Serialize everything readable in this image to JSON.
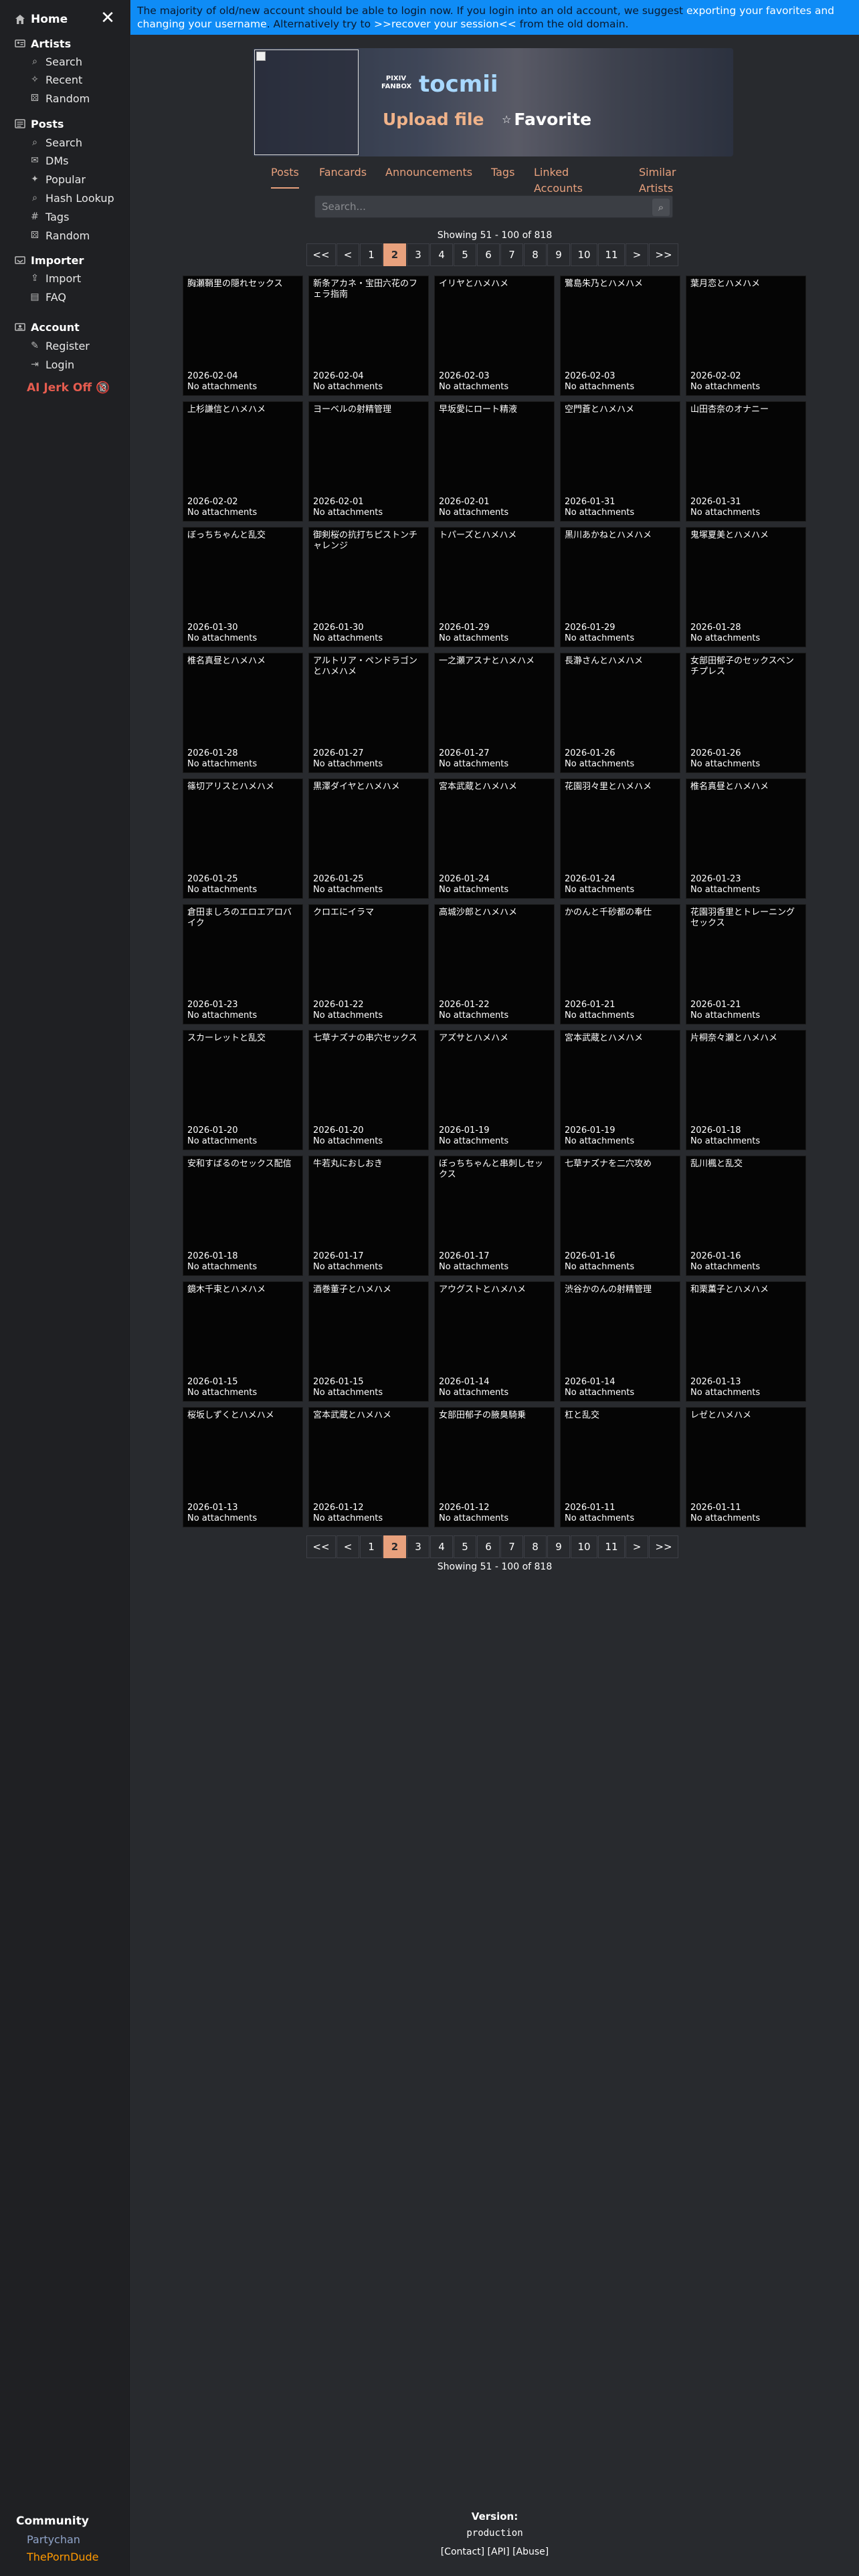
{
  "sidebar": {
    "home": "Home",
    "close": "✕",
    "sections": [
      {
        "title": "Artists",
        "items": [
          "Search",
          "Recent",
          "Random"
        ]
      },
      {
        "title": "Posts",
        "items": [
          "Search",
          "DMs",
          "Popular",
          "Hash Lookup",
          "Tags",
          "Random"
        ]
      },
      {
        "title": "Importer",
        "items": [
          "Import",
          "FAQ"
        ]
      },
      {
        "title": "Account",
        "items": [
          "Register",
          "Login"
        ]
      }
    ],
    "special": "AI Jerk Off 🔞",
    "community": {
      "title": "Community",
      "links": [
        "Partychan",
        "ThePornDude"
      ]
    }
  },
  "banner": {
    "text1": "The majority of old/new account should be able to login now. If you login into an old account, we suggest ",
    "link1": "exporting your favorites and changing your username",
    "text2": ". Alternatively try to ",
    "link2": ">>recover your session<<",
    "text3": " from the old domain."
  },
  "profile": {
    "service": "PIXIV FANBOX",
    "name": "tocmii",
    "upload": "Upload file",
    "favorite": "Favorite",
    "favorite_icon": "☆"
  },
  "tabs": [
    "Posts",
    "Fancards",
    "Announcements",
    "Tags",
    "Linked Accounts",
    "Similar Artists"
  ],
  "search": {
    "placeholder": "Search..."
  },
  "showing": "Showing 51 - 100 of 818",
  "pagination": [
    "<<",
    "<",
    "1",
    "2",
    "3",
    "4",
    "5",
    "6",
    "7",
    "8",
    "9",
    "10",
    "11",
    ">",
    ">>"
  ],
  "pagination_current": "2",
  "posts": [
    {
      "title": "胸瀬鞘里の隠れセックス",
      "date": "2026-02-04",
      "attachments": "No attachments"
    },
    {
      "title": "新条アカネ・宝田六花のフェラ指南",
      "date": "2026-02-04",
      "attachments": "No attachments"
    },
    {
      "title": "イリヤとハメハメ",
      "date": "2026-02-03",
      "attachments": "No attachments"
    },
    {
      "title": "鷺島朱乃とハメハメ",
      "date": "2026-02-03",
      "attachments": "No attachments"
    },
    {
      "title": "葉月恋とハメハメ",
      "date": "2026-02-02",
      "attachments": "No attachments"
    },
    {
      "title": "上杉謙信とハメハメ",
      "date": "2026-02-02",
      "attachments": "No attachments"
    },
    {
      "title": "ヨーベルの射精管理",
      "date": "2026-02-01",
      "attachments": "No attachments"
    },
    {
      "title": "早坂愛にロート精液",
      "date": "2026-02-01",
      "attachments": "No attachments"
    },
    {
      "title": "空門蒼とハメハメ",
      "date": "2026-01-31",
      "attachments": "No attachments"
    },
    {
      "title": "山田杏奈のオナニー",
      "date": "2026-01-31",
      "attachments": "No attachments"
    },
    {
      "title": "ぼっちちゃんと乱交",
      "date": "2026-01-30",
      "attachments": "No attachments"
    },
    {
      "title": "御剣桜の抗打ちピストンチャレンジ",
      "date": "2026-01-30",
      "attachments": "No attachments"
    },
    {
      "title": "トパーズとハメハメ",
      "date": "2026-01-29",
      "attachments": "No attachments"
    },
    {
      "title": "黒川あかねとハメハメ",
      "date": "2026-01-29",
      "attachments": "No attachments"
    },
    {
      "title": "鬼塚夏美とハメハメ",
      "date": "2026-01-28",
      "attachments": "No attachments"
    },
    {
      "title": "椎名真昼とハメハメ",
      "date": "2026-01-28",
      "attachments": "No attachments"
    },
    {
      "title": "アルトリア・ペンドラゴンとハメハメ",
      "date": "2026-01-27",
      "attachments": "No attachments"
    },
    {
      "title": "一之瀬アスナとハメハメ",
      "date": "2026-01-27",
      "attachments": "No attachments"
    },
    {
      "title": "長瀞さんとハメハメ",
      "date": "2026-01-26",
      "attachments": "No attachments"
    },
    {
      "title": "女部田郁子のセックスベンチプレス",
      "date": "2026-01-26",
      "attachments": "No attachments"
    },
    {
      "title": "篠切アリスとハメハメ",
      "date": "2026-01-25",
      "attachments": "No attachments"
    },
    {
      "title": "黒澤ダイヤとハメハメ",
      "date": "2026-01-25",
      "attachments": "No attachments"
    },
    {
      "title": "宮本武蔵とハメハメ",
      "date": "2026-01-24",
      "attachments": "No attachments"
    },
    {
      "title": "花園羽々里とハメハメ",
      "date": "2026-01-24",
      "attachments": "No attachments"
    },
    {
      "title": "椎名真昼とハメハメ",
      "date": "2026-01-23",
      "attachments": "No attachments"
    },
    {
      "title": "倉田ましろのエロエアロバイク",
      "date": "2026-01-23",
      "attachments": "No attachments"
    },
    {
      "title": "クロエにイラマ",
      "date": "2026-01-22",
      "attachments": "No attachments"
    },
    {
      "title": "高城沙郎とハメハメ",
      "date": "2026-01-22",
      "attachments": "No attachments"
    },
    {
      "title": "かのんと千砂都の奉仕",
      "date": "2026-01-21",
      "attachments": "No attachments"
    },
    {
      "title": "花園羽香里とトレーニングセックス",
      "date": "2026-01-21",
      "attachments": "No attachments"
    },
    {
      "title": "スカーレットと乱交",
      "date": "2026-01-20",
      "attachments": "No attachments"
    },
    {
      "title": "七草ナズナの串穴セックス",
      "date": "2026-01-20",
      "attachments": "No attachments"
    },
    {
      "title": "アズサとハメハメ",
      "date": "2026-01-19",
      "attachments": "No attachments"
    },
    {
      "title": "宮本武蔵とハメハメ",
      "date": "2026-01-19",
      "attachments": "No attachments"
    },
    {
      "title": "片桐奈々瀬とハメハメ",
      "date": "2026-01-18",
      "attachments": "No attachments"
    },
    {
      "title": "安和すばるのセックス配信",
      "date": "2026-01-18",
      "attachments": "No attachments"
    },
    {
      "title": "牛若丸におしおき",
      "date": "2026-01-17",
      "attachments": "No attachments"
    },
    {
      "title": "ぼっちちゃんと串刺しセックス",
      "date": "2026-01-17",
      "attachments": "No attachments"
    },
    {
      "title": "七草ナズナを二穴攻め",
      "date": "2026-01-16",
      "attachments": "No attachments"
    },
    {
      "title": "乱川楓と乱交",
      "date": "2026-01-16",
      "attachments": "No attachments"
    },
    {
      "title": "鏡木千束とハメハメ",
      "date": "2026-01-15",
      "attachments": "No attachments"
    },
    {
      "title": "酒巻董子とハメハメ",
      "date": "2026-01-15",
      "attachments": "No attachments"
    },
    {
      "title": "アウグストとハメハメ",
      "date": "2026-01-14",
      "attachments": "No attachments"
    },
    {
      "title": "渋谷かのんの射精管理",
      "date": "2026-01-14",
      "attachments": "No attachments"
    },
    {
      "title": "和栗薫子とハメハメ",
      "date": "2026-01-13",
      "attachments": "No attachments"
    },
    {
      "title": "桜坂しずくとハメハメ",
      "date": "2026-01-13",
      "attachments": "No attachments"
    },
    {
      "title": "宮本武蔵とハメハメ",
      "date": "2026-01-12",
      "attachments": "No attachments"
    },
    {
      "title": "女部田郁子の腋臭騎乗",
      "date": "2026-01-12",
      "attachments": "No attachments"
    },
    {
      "title": "杠と乱交",
      "date": "2026-01-11",
      "attachments": "No attachments"
    },
    {
      "title": "レゼとハメハメ",
      "date": "2026-01-11",
      "attachments": "No attachments"
    }
  ],
  "footer": {
    "version_label": "Version:",
    "version_value": "production",
    "links": "[Contact]  [API]  [Abuse]"
  }
}
